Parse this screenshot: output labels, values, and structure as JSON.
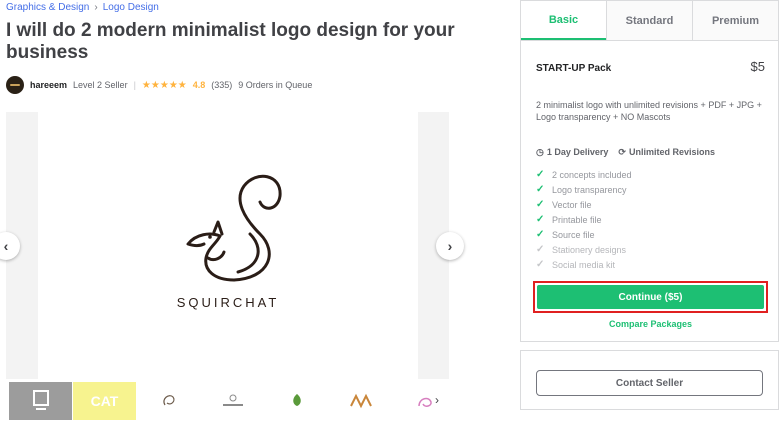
{
  "breadcrumb": {
    "category": "Graphics & Design",
    "separator": "›",
    "subcategory": "Logo Design"
  },
  "gig": {
    "title": "I will do 2 modern minimalist logo design for your business"
  },
  "seller": {
    "name": "hareeem",
    "level": "Level 2 Seller",
    "divider": "|",
    "stars": "★★★★★",
    "rating": "4.8",
    "rating_count": "(335)",
    "orders_in_queue": "9 Orders in Queue"
  },
  "gallery": {
    "prev_icon": "chevron-left-icon",
    "next_icon": "chevron-right-icon",
    "logo_text": "SQUIRCHAT",
    "thumbnails": [
      "",
      "CAT",
      "",
      "",
      "",
      "",
      ""
    ]
  },
  "package_tabs": [
    "Basic",
    "Standard",
    "Premium"
  ],
  "package": {
    "name": "START-UP Pack",
    "price": "$5",
    "description": "2 minimalist logo with unlimited revisions + PDF + JPG + Logo transparency + NO Mascots",
    "delivery": "1 Day Delivery",
    "revisions": "Unlimited Revisions",
    "features": [
      {
        "label": "2 concepts included",
        "included": true
      },
      {
        "label": "Logo transparency",
        "included": true
      },
      {
        "label": "Vector file",
        "included": true
      },
      {
        "label": "Printable file",
        "included": true
      },
      {
        "label": "Source file",
        "included": true
      },
      {
        "label": "Stationery designs",
        "included": false
      },
      {
        "label": "Social media kit",
        "included": false
      }
    ],
    "continue_label": "Continue ($5)",
    "compare_label": "Compare Packages"
  },
  "contact": {
    "label": "Contact Seller"
  },
  "colors": {
    "accent": "#1dbf73",
    "star": "#ffb33e",
    "link": "#446ee7",
    "highlight_border": "#e02020"
  }
}
